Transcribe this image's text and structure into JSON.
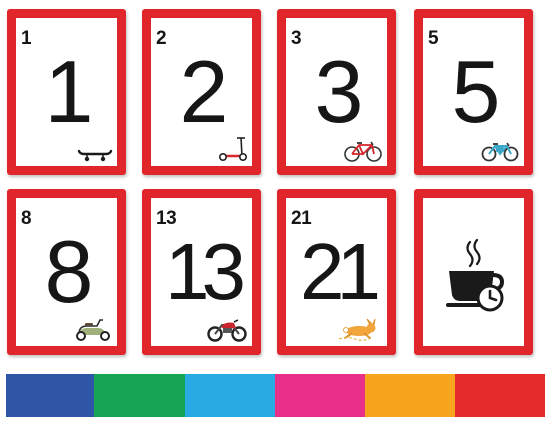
{
  "cards": [
    {
      "small": "1",
      "big": "1",
      "icon": "skateboard-icon"
    },
    {
      "small": "2",
      "big": "2",
      "icon": "kick-scooter-icon"
    },
    {
      "small": "3",
      "big": "3",
      "icon": "bicycle-icon"
    },
    {
      "small": "5",
      "big": "5",
      "icon": "electric-bicycle-icon"
    },
    {
      "small": "8",
      "big": "8",
      "icon": "motor-scooter-icon"
    },
    {
      "small": "13",
      "big": "13",
      "icon": "motorcycle-icon"
    },
    {
      "small": "21",
      "big": "21",
      "icon": "fast-rabbit-icon"
    },
    {
      "icon": "coffee-break-icon"
    }
  ],
  "colors": {
    "card_border": "#e0262b",
    "stripes": [
      "#2f55a6",
      "#16a553",
      "#2aaae2",
      "#e8308a",
      "#f7a51c",
      "#e52b2b"
    ]
  }
}
